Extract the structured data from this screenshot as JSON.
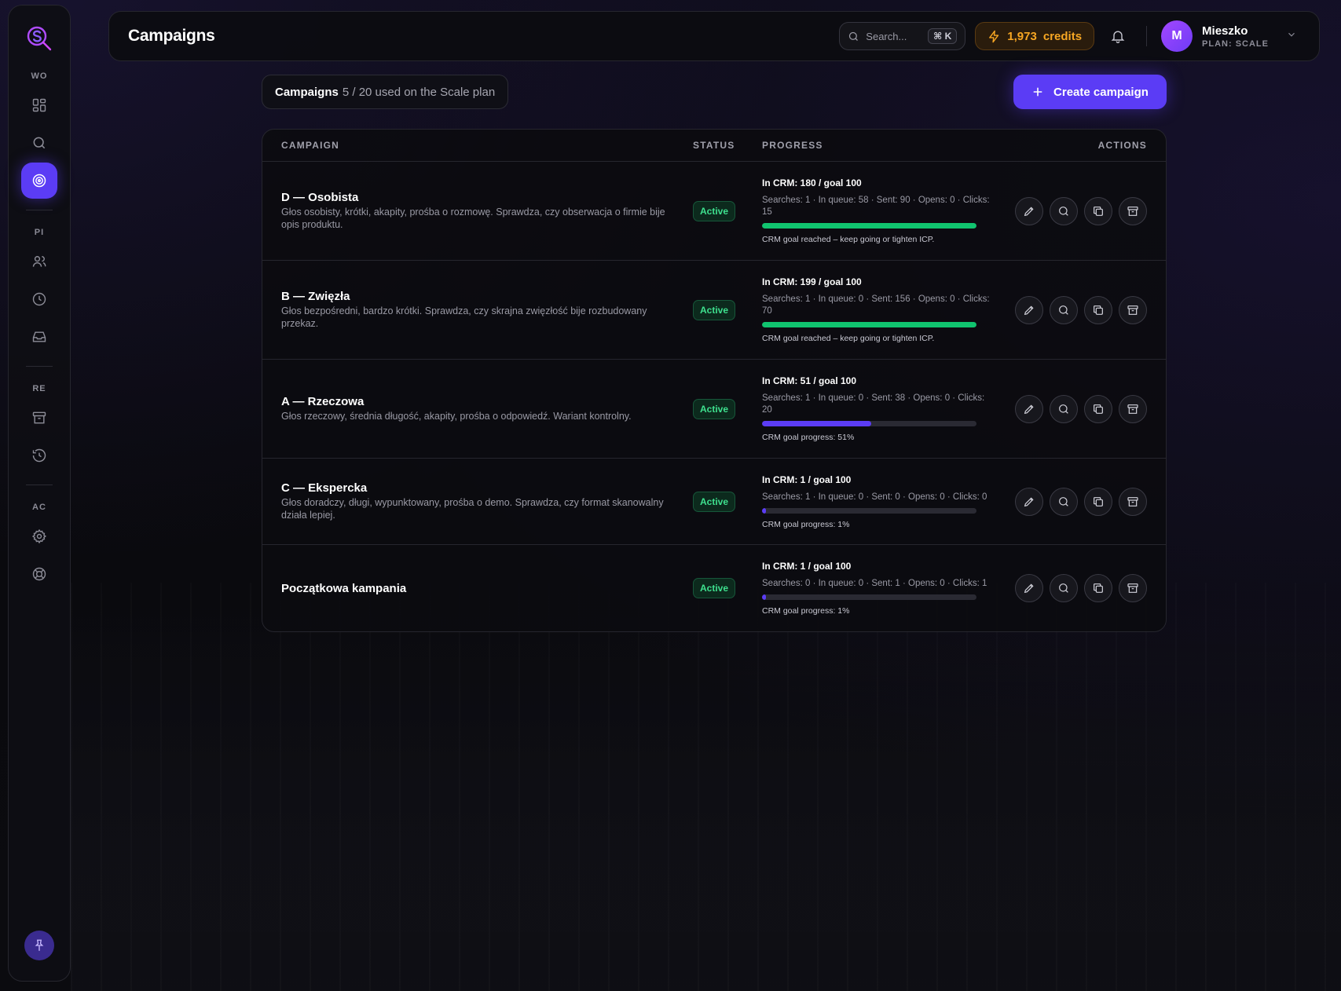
{
  "sidebar": {
    "sections": [
      "WO",
      "PI",
      "RE",
      "AC"
    ]
  },
  "header": {
    "title": "Campaigns",
    "search_placeholder": "Search...",
    "search_shortcut": "⌘ K",
    "credits": "1,973",
    "credits_label": "credits",
    "user": {
      "initial": "M",
      "name": "Mieszko",
      "plan": "PLAN: SCALE"
    }
  },
  "toolbar": {
    "usage_label": "Campaigns",
    "usage_text": "5 / 20 used on the Scale plan",
    "create_label": "Create campaign"
  },
  "table": {
    "headers": {
      "campaign": "CAMPAIGN",
      "status": "STATUS",
      "progress": "PROGRESS",
      "actions": "ACTIONS"
    },
    "rows": [
      {
        "name": "D — Osobista",
        "description": "Głos osobisty, krótki, akapity, prośba o rozmowę. Sprawdza, czy obserwacja o firmie bije opis produktu.",
        "status": "Active",
        "progress_title": "In CRM: 180 / goal 100",
        "stats": "Searches: 1 · In queue: 58 · Sent: 90 · Opens: 0 · Clicks: 15",
        "progress_fraction": 1.0,
        "bar_color": "green",
        "note": "CRM goal reached – keep going or tighten ICP."
      },
      {
        "name": "B — Zwięzła",
        "description": "Głos bezpośredni, bardzo krótki. Sprawdza, czy skrajna zwięzłość bije rozbudowany przekaz.",
        "status": "Active",
        "progress_title": "In CRM: 199 / goal 100",
        "stats": "Searches: 1 · In queue: 0 · Sent: 156 · Opens: 0 · Clicks: 70",
        "progress_fraction": 1.0,
        "bar_color": "green",
        "note": "CRM goal reached – keep going or tighten ICP."
      },
      {
        "name": "A — Rzeczowa",
        "description": "Głos rzeczowy, średnia długość, akapity, prośba o odpowiedź. Wariant kontrolny.",
        "status": "Active",
        "progress_title": "In CRM: 51 / goal 100",
        "stats": "Searches: 1 · In queue: 0 · Sent: 38 · Opens: 0 · Clicks: 20",
        "progress_fraction": 0.51,
        "bar_color": "purple",
        "note": "CRM goal progress: 51%"
      },
      {
        "name": "C — Ekspercka",
        "description": "Głos doradczy, długi, wypunktowany, prośba o demo. Sprawdza, czy format skanowalny działa lepiej.",
        "status": "Active",
        "progress_title": "In CRM: 1 / goal 100",
        "stats": "Searches: 1 · In queue: 0 · Sent: 0 · Opens: 0 · Clicks: 0",
        "progress_fraction": 0.01,
        "bar_color": "purple",
        "note": "CRM goal progress: 1%"
      },
      {
        "name": "Początkowa kampania",
        "description": "",
        "status": "Active",
        "progress_title": "In CRM: 1 / goal 100",
        "stats": "Searches: 0 · In queue: 0 · Sent: 1 · Opens: 0 · Clicks: 1",
        "progress_fraction": 0.01,
        "bar_color": "purple",
        "note": "CRM goal progress: 1%"
      }
    ]
  },
  "icons": {
    "row_actions": [
      "pencil-icon",
      "search-icon",
      "copy-icon",
      "archive-icon"
    ]
  },
  "colors": {
    "accent": "#5b3cf5",
    "success": "#10c46f",
    "credits": "#f6a623"
  }
}
